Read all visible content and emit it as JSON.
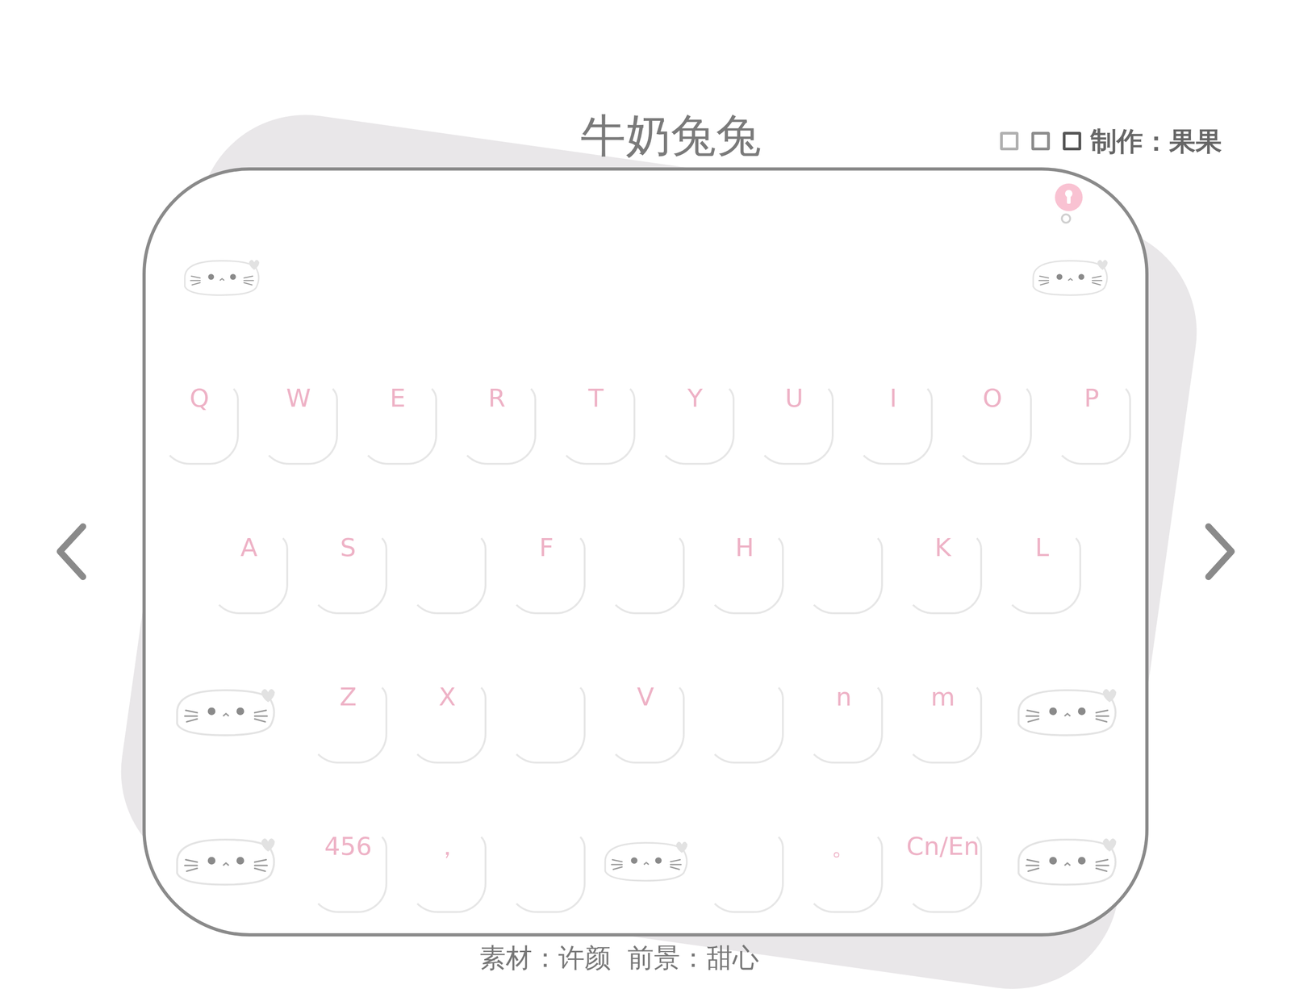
{
  "title": "牛奶兔兔",
  "credit": "制作：果果",
  "footer": "素材：许颜  前景：甜心",
  "keyboard": {
    "toolbar": [
      {
        "kind": "cat"
      },
      {
        "kind": "cat"
      }
    ],
    "rows": [
      {
        "keys": [
          {
            "kind": "label",
            "label": "Q"
          },
          {
            "kind": "label",
            "label": "W"
          },
          {
            "kind": "label",
            "label": "E"
          },
          {
            "kind": "label",
            "label": "R"
          },
          {
            "kind": "label",
            "label": "T"
          },
          {
            "kind": "label",
            "label": "Y"
          },
          {
            "kind": "label",
            "label": "U"
          },
          {
            "kind": "label",
            "label": "I"
          },
          {
            "kind": "label",
            "label": "O"
          },
          {
            "kind": "label",
            "label": "P"
          }
        ]
      },
      {
        "keys": [
          {
            "kind": "label",
            "label": "A"
          },
          {
            "kind": "label",
            "label": "S"
          },
          {
            "kind": "blank"
          },
          {
            "kind": "label",
            "label": "F"
          },
          {
            "kind": "blank"
          },
          {
            "kind": "label",
            "label": "H"
          },
          {
            "kind": "blank"
          },
          {
            "kind": "label",
            "label": "K"
          },
          {
            "kind": "label",
            "label": "L"
          }
        ]
      },
      {
        "keys": [
          {
            "kind": "cat"
          },
          {
            "kind": "label",
            "label": "Z"
          },
          {
            "kind": "label",
            "label": "X"
          },
          {
            "kind": "blank"
          },
          {
            "kind": "label",
            "label": "V"
          },
          {
            "kind": "blank"
          },
          {
            "kind": "label",
            "label": "n"
          },
          {
            "kind": "label",
            "label": "m"
          },
          {
            "kind": "cat"
          }
        ]
      },
      {
        "keys": [
          {
            "kind": "cat"
          },
          {
            "kind": "label",
            "label": "456"
          },
          {
            "kind": "label",
            "label": "，"
          },
          {
            "kind": "blank"
          },
          {
            "kind": "space"
          },
          {
            "kind": "blank"
          },
          {
            "kind": "label",
            "label": "。"
          },
          {
            "kind": "label",
            "label": "Cn/En"
          },
          {
            "kind": "cat"
          }
        ]
      }
    ]
  }
}
